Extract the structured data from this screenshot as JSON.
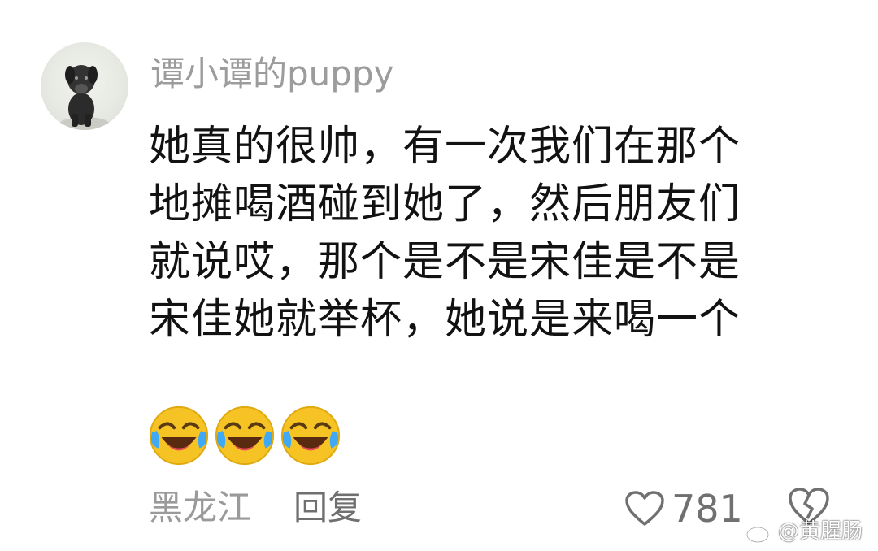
{
  "comment": {
    "username": "谭小谭的puppy",
    "lines": [
      "她真的很帅，有一次我们在那个",
      "地摊喝酒碰到她了，然后朋友们",
      "就说哎，那个是不是宋佳是不是",
      "宋佳她就举杯，她说是来喝一个"
    ],
    "emojis": [
      "laughing-crying-emoji",
      "laughing-crying-emoji",
      "laughing-crying-emoji"
    ],
    "location": "黑龙江",
    "reply_label": "回复",
    "like_count": "781"
  },
  "icons": {
    "like": "heart-outline-icon",
    "dislike": "broken-heart-icon",
    "watermark_logo": "weibo-logo-icon"
  },
  "watermark": {
    "text": "@黄腥肠"
  },
  "colors": {
    "username": "#9c9c9c",
    "body_text": "#121212",
    "meta_text": "#9a9a9a",
    "icon_gray": "#707070",
    "emoji_yellow": "#f6c325",
    "emoji_tear": "#3fa9f5"
  }
}
